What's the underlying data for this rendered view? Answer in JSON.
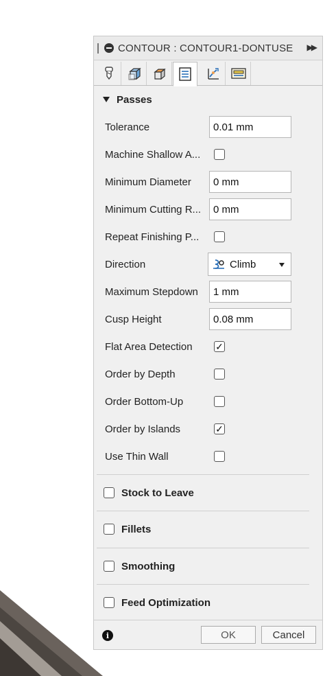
{
  "panel": {
    "title": "CONTOUR : CONTOUR1-DONTUSE",
    "tabs": [
      {
        "icon": "tool-icon"
      },
      {
        "icon": "geometry-icon"
      },
      {
        "icon": "heights-icon"
      },
      {
        "icon": "passes-icon",
        "active": true
      },
      {
        "icon": "linking-icon"
      },
      {
        "icon": "post-process-icon"
      }
    ]
  },
  "passes": {
    "title": "Passes",
    "fields": {
      "tolerance": {
        "label": "Tolerance",
        "value": "0.01 mm"
      },
      "machine_shallow": {
        "label": "Machine Shallow A...",
        "checked": false
      },
      "min_diameter": {
        "label": "Minimum Diameter",
        "value": "0 mm"
      },
      "min_cutting": {
        "label": "Minimum Cutting R...",
        "value": "0 mm"
      },
      "repeat_finishing": {
        "label": "Repeat Finishing P...",
        "checked": false
      },
      "direction": {
        "label": "Direction",
        "value": "Climb"
      },
      "max_stepdown": {
        "label": "Maximum Stepdown",
        "value": "1 mm"
      },
      "cusp_height": {
        "label": "Cusp Height",
        "value": "0.08 mm"
      },
      "flat_area": {
        "label": "Flat Area Detection",
        "checked": true
      },
      "order_depth": {
        "label": "Order by Depth",
        "checked": false
      },
      "order_bottom_up": {
        "label": "Order Bottom-Up",
        "checked": false
      },
      "order_islands": {
        "label": "Order by Islands",
        "checked": true
      },
      "thin_wall": {
        "label": "Use Thin Wall",
        "checked": false
      }
    }
  },
  "groups": {
    "stock": {
      "label": "Stock to Leave",
      "checked": false
    },
    "fillets": {
      "label": "Fillets",
      "checked": false
    },
    "smoothing": {
      "label": "Smoothing",
      "checked": false
    },
    "feed": {
      "label": "Feed Optimization",
      "checked": false
    }
  },
  "footer": {
    "info_icon_glyph": "i",
    "ok_label": "OK",
    "cancel_label": "Cancel"
  },
  "checkmark_glyph": "✓"
}
